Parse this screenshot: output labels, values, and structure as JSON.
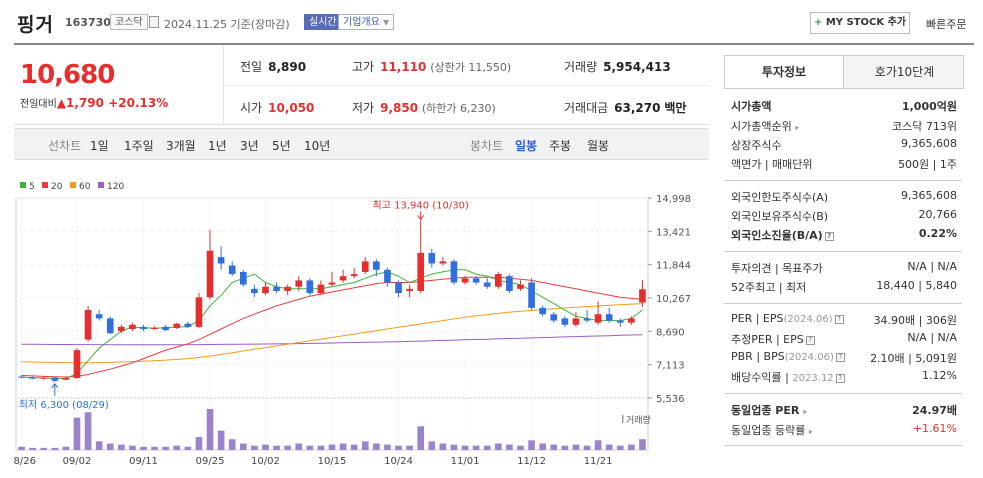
{
  "header": {
    "name": "핑거",
    "code": "163730",
    "market": "코스닥",
    "date": "2024.11.25 기준(장마감)",
    "realtime": "실시간",
    "overview": "기업개요",
    "mystock": "MY STOCK 추가",
    "quick": "빠른주문"
  },
  "summary": {
    "price": "10,680",
    "change_label": "전일대비",
    "change": "▲1,790",
    "change_pct": "+20.13%",
    "prev_label": "전일",
    "prev": "8,890",
    "high_label": "고가",
    "high": "11,110",
    "high_sub": "(상한가 11,550)",
    "volume_label": "거래량",
    "volume": "5,954,413",
    "open_label": "시가",
    "open": "10,050",
    "low_label": "저가",
    "low": "9,850",
    "low_sub": "(하한가 6,230)",
    "amount_label": "거래대금",
    "amount": "63,270",
    "amount_unit": "백만"
  },
  "tabs": {
    "line_label": "선차트",
    "periods": [
      "1일",
      "1주일",
      "3개월",
      "1년",
      "3년",
      "5년",
      "10년"
    ],
    "candle_label": "봉차트",
    "candle": [
      "일봉",
      "주봉",
      "월봉"
    ]
  },
  "colors": {
    "up": "#e62e2e",
    "down": "#2f6fe0",
    "ma5": "#3cb43c",
    "ma20": "#e83c3c",
    "ma60": "#f39a1f",
    "ma120": "#9a5cc8"
  },
  "chart_data": {
    "type": "candlestick",
    "legend": [
      "5",
      "20",
      "60",
      "120"
    ],
    "y_ticks": [
      "14,998",
      "13,421",
      "11,844",
      "10,267",
      "8,690",
      "7,113",
      "5,536"
    ],
    "ylim": [
      5536,
      14998
    ],
    "x_labels": [
      "08/26",
      "09/02",
      "09/11",
      "09/25",
      "10/02",
      "10/15",
      "10/24",
      "11/01",
      "11/12",
      "11/21"
    ],
    "x_label_index": [
      0,
      5,
      11,
      17,
      22,
      28,
      34,
      40,
      46,
      52
    ],
    "high_annotation": "최고 13,940 (10/30)",
    "low_annotation": "최저 6,300 (08/29)",
    "volume_label": "거래량",
    "candles": [
      [
        6550,
        6500,
        6600,
        6480
      ],
      [
        6500,
        6450,
        6560,
        6420
      ],
      [
        6450,
        6500,
        6550,
        6400
      ],
      [
        6500,
        6350,
        6520,
        6300
      ],
      [
        6400,
        6480,
        6520,
        6380
      ],
      [
        6480,
        7800,
        7900,
        6450
      ],
      [
        8300,
        9700,
        9900,
        8200
      ],
      [
        9500,
        9300,
        9700,
        9200
      ],
      [
        9300,
        8600,
        9400,
        8550
      ],
      [
        8700,
        8900,
        9000,
        8600
      ],
      [
        8800,
        9000,
        9100,
        8700
      ],
      [
        8900,
        8800,
        9000,
        8700
      ],
      [
        8800,
        8850,
        8950,
        8750
      ],
      [
        8900,
        8750,
        9000,
        8700
      ],
      [
        8850,
        9050,
        9100,
        8800
      ],
      [
        9050,
        8900,
        9150,
        8850
      ],
      [
        8900,
        10300,
        10500,
        8850
      ],
      [
        10300,
        12500,
        13500,
        10200
      ],
      [
        12200,
        11900,
        12700,
        11600
      ],
      [
        11800,
        11400,
        12000,
        11300
      ],
      [
        11500,
        10900,
        11600,
        10800
      ],
      [
        10700,
        10500,
        10900,
        10300
      ],
      [
        10500,
        10800,
        11000,
        10400
      ],
      [
        10800,
        10600,
        11000,
        10500
      ],
      [
        10600,
        10800,
        10900,
        10400
      ],
      [
        10800,
        11100,
        11300,
        10600
      ],
      [
        11100,
        10500,
        11200,
        10400
      ],
      [
        10500,
        10900,
        11100,
        10400
      ],
      [
        10900,
        11000,
        11500,
        10800
      ],
      [
        11100,
        11300,
        11600,
        11000
      ],
      [
        11300,
        11400,
        11700,
        11200
      ],
      [
        11500,
        12000,
        12200,
        11400
      ],
      [
        12000,
        11600,
        12100,
        11300
      ],
      [
        11600,
        11000,
        11700,
        10800
      ],
      [
        11000,
        10500,
        11100,
        10300
      ],
      [
        10600,
        10700,
        10900,
        10300
      ],
      [
        10600,
        12400,
        13940,
        10500
      ],
      [
        12400,
        11900,
        12600,
        11700
      ],
      [
        11900,
        12000,
        12200,
        11800
      ],
      [
        12000,
        11000,
        12100,
        10900
      ],
      [
        11000,
        11200,
        11300,
        10900
      ],
      [
        11200,
        11000,
        11300,
        10900
      ],
      [
        11000,
        10800,
        11200,
        10700
      ],
      [
        10800,
        11400,
        11500,
        10700
      ],
      [
        11300,
        10600,
        11400,
        10500
      ],
      [
        10700,
        10900,
        11100,
        10600
      ],
      [
        11000,
        9800,
        11200,
        9700
      ],
      [
        9800,
        9500,
        9900,
        9400
      ],
      [
        9500,
        9200,
        9600,
        9100
      ],
      [
        9300,
        9000,
        9400,
        8900
      ],
      [
        9000,
        9300,
        9600,
        8900
      ],
      [
        9300,
        9200,
        9700,
        9100
      ],
      [
        9100,
        9500,
        10100,
        9000
      ],
      [
        9500,
        9200,
        9800,
        9100
      ],
      [
        9200,
        9100,
        9300,
        8900
      ],
      [
        9100,
        9300,
        9400,
        9000
      ],
      [
        10050,
        10680,
        11110,
        9850
      ]
    ],
    "volumes": [
      3,
      2,
      2,
      2,
      3,
      30,
      35,
      8,
      6,
      5,
      4,
      3,
      3,
      3,
      4,
      3,
      12,
      38,
      18,
      10,
      6,
      4,
      5,
      4,
      4,
      6,
      4,
      4,
      5,
      6,
      5,
      8,
      6,
      5,
      4,
      4,
      22,
      8,
      6,
      5,
      4,
      4,
      4,
      6,
      5,
      4,
      9,
      6,
      5,
      4,
      5,
      4,
      9,
      5,
      4,
      5,
      10
    ],
    "ma5": [
      6520,
      6500,
      6480,
      6460,
      6450,
      6700,
      7300,
      7900,
      8300,
      8700,
      8900,
      8850,
      8850,
      8850,
      8900,
      8900,
      9200,
      9900,
      10400,
      11000,
      11200,
      11400,
      11000,
      10800,
      10700,
      10700,
      10700,
      10700,
      10800,
      10900,
      11000,
      11200,
      11400,
      11500,
      11300,
      11000,
      11200,
      11400,
      11500,
      11600,
      11600,
      11400,
      11300,
      11100,
      11000,
      10900,
      10600,
      10300,
      10000,
      9700,
      9400,
      9300,
      9200,
      9200,
      9200,
      9300,
      9700
    ],
    "ma20": [
      6600,
      6580,
      6560,
      6540,
      6530,
      6560,
      6650,
      6780,
      6900,
      7050,
      7200,
      7400,
      7600,
      7800,
      7950,
      8100,
      8300,
      8550,
      8800,
      9050,
      9300,
      9500,
      9700,
      9900,
      10050,
      10200,
      10350,
      10450,
      10550,
      10650,
      10750,
      10850,
      10950,
      11000,
      11000,
      11000,
      11050,
      11100,
      11150,
      11200,
      11250,
      11250,
      11250,
      11250,
      11200,
      11150,
      11100,
      11000,
      10900,
      10800,
      10700,
      10600,
      10500,
      10400,
      10300,
      10250,
      10200
    ],
    "ma60": [
      7250,
      7240,
      7230,
      7220,
      7210,
      7200,
      7200,
      7210,
      7220,
      7240,
      7260,
      7280,
      7300,
      7330,
      7360,
      7400,
      7450,
      7520,
      7600,
      7680,
      7760,
      7840,
      7920,
      8000,
      8080,
      8160,
      8240,
      8320,
      8400,
      8480,
      8560,
      8640,
      8720,
      8800,
      8880,
      8960,
      9040,
      9120,
      9200,
      9280,
      9360,
      9420,
      9480,
      9540,
      9600,
      9640,
      9680,
      9720,
      9760,
      9800,
      9830,
      9860,
      9890,
      9920,
      9950,
      9980,
      10000
    ],
    "ma120": [
      8080,
      8075,
      8070,
      8068,
      8066,
      8064,
      8062,
      8060,
      8058,
      8057,
      8056,
      8055,
      8055,
      8056,
      8057,
      8058,
      8060,
      8065,
      8070,
      8075,
      8080,
      8085,
      8090,
      8095,
      8100,
      8110,
      8120,
      8130,
      8140,
      8150,
      8160,
      8170,
      8180,
      8190,
      8200,
      8215,
      8230,
      8245,
      8260,
      8275,
      8290,
      8305,
      8320,
      8335,
      8350,
      8365,
      8380,
      8395,
      8410,
      8425,
      8440,
      8455,
      8470,
      8485,
      8500,
      8515,
      8530
    ]
  },
  "info": {
    "tab_active": "투자정보",
    "tab_other": "호가10단계",
    "market_cap_label": "시가총액",
    "market_cap": "1,000억원",
    "cap_rank_label": "시가총액순위",
    "cap_rank": "코스닥 713위",
    "shares_label": "상장주식수",
    "shares": "9,365,608",
    "par_label": "액면가 | 매매단위",
    "par": "500원 | 1주",
    "foreign_limit_label": "외국인한도주식수(A)",
    "foreign_limit": "9,365,608",
    "foreign_hold_label": "외국인보유주식수(B)",
    "foreign_hold": "20,766",
    "foreign_ratio_label": "외국인소진율(B/A)",
    "foreign_ratio": "0.22%",
    "opinion_label": "투자의견 | 목표주가",
    "opinion": "N/A | N/A",
    "w52_label": "52주최고 | 최저",
    "w52": "18,440 | 5,840",
    "per_label": "PER | EPS",
    "per_date": "(2024.06)",
    "per": "34.90배 | 306원",
    "est_per_label": "추정PER | EPS",
    "est_per": "N/A | N/A",
    "pbr_label": "PBR | BPS",
    "pbr_date": "(2024.06)",
    "pbr": "2.10배 | 5,091원",
    "div_label": "배당수익률 | ",
    "div_date": "2023.12",
    "div": "1.12%",
    "sector_per_label": "동일업종 PER",
    "sector_per": "24.97배",
    "sector_chg_label": "동일업종 등락률",
    "sector_chg": "+1.61%"
  }
}
